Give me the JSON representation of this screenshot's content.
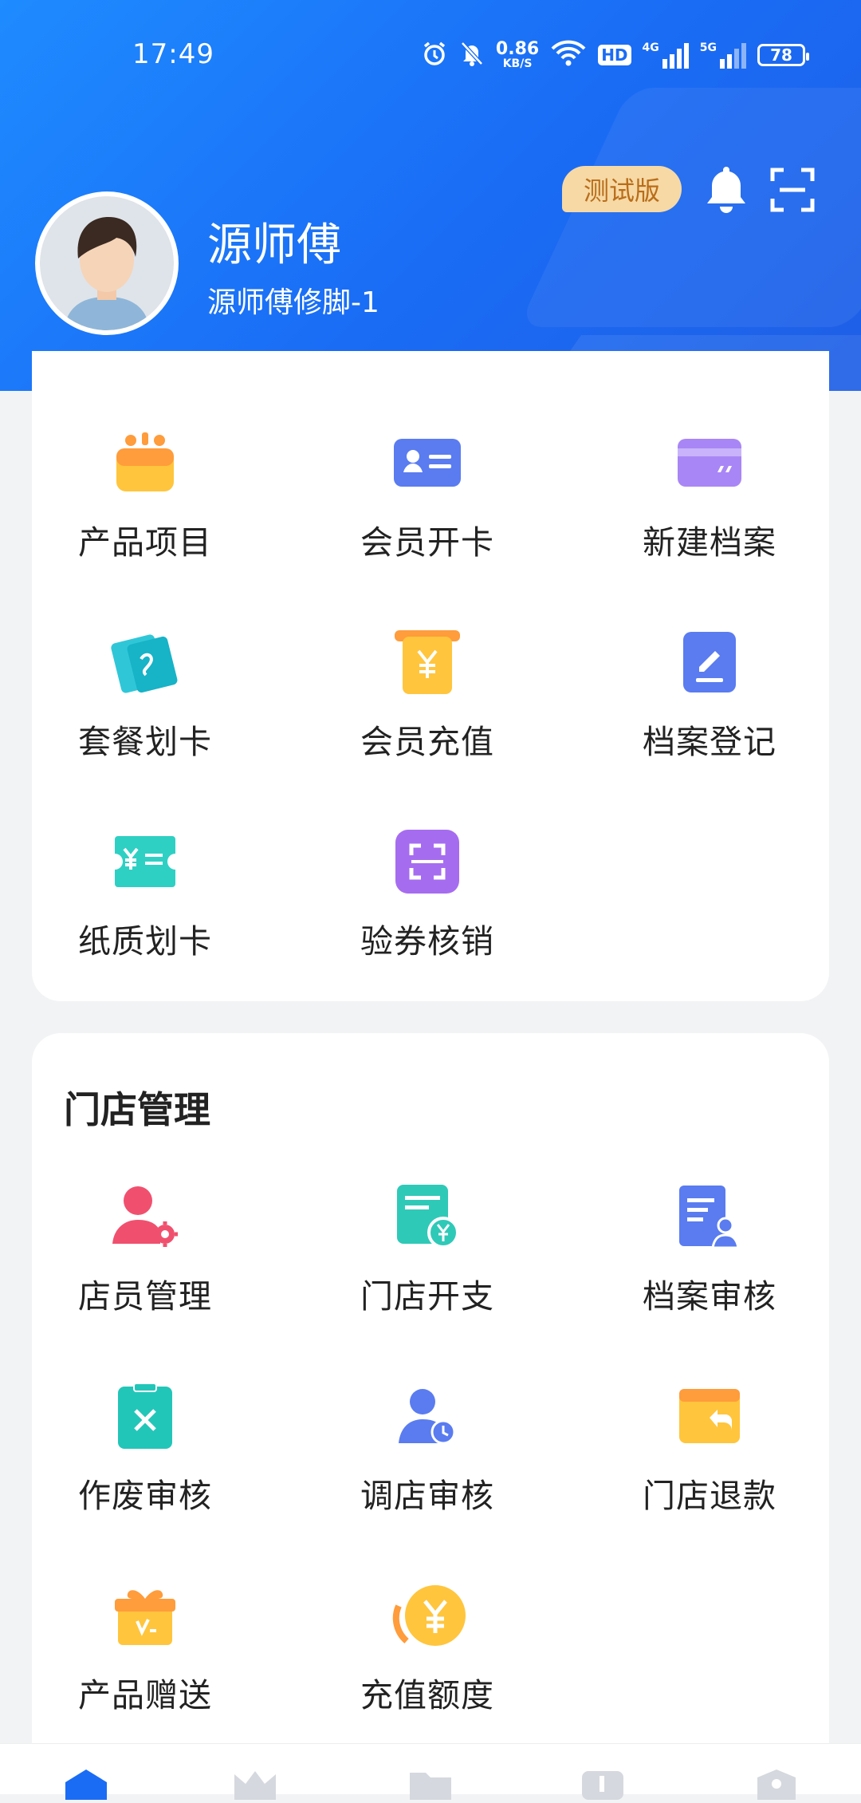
{
  "status_bar": {
    "time": "17:49",
    "net_speed": "0.86",
    "net_unit": "KB/S",
    "hd": "HD",
    "signal1": "4G",
    "signal2": "5G",
    "battery": "78"
  },
  "header": {
    "badge": "测试版",
    "user_name": "源师傅",
    "shop_name": "源师傅修脚-1"
  },
  "quick_actions": {
    "items": [
      {
        "label": "产品项目"
      },
      {
        "label": "会员开卡"
      },
      {
        "label": "新建档案"
      },
      {
        "label": "套餐划卡"
      },
      {
        "label": "会员充值"
      },
      {
        "label": "档案登记"
      },
      {
        "label": "纸质划卡"
      },
      {
        "label": "验券核销"
      }
    ]
  },
  "store_management": {
    "title": "门店管理",
    "items": [
      {
        "label": "店员管理"
      },
      {
        "label": "门店开支"
      },
      {
        "label": "档案审核"
      },
      {
        "label": "作废审核"
      },
      {
        "label": "调店审核"
      },
      {
        "label": "门店退款"
      },
      {
        "label": "产品赠送"
      },
      {
        "label": "充值额度"
      }
    ]
  },
  "colors": {
    "header_blue": "#1a6cf5",
    "badge_bg": "#f6d9a5",
    "badge_text": "#b96d1a"
  }
}
